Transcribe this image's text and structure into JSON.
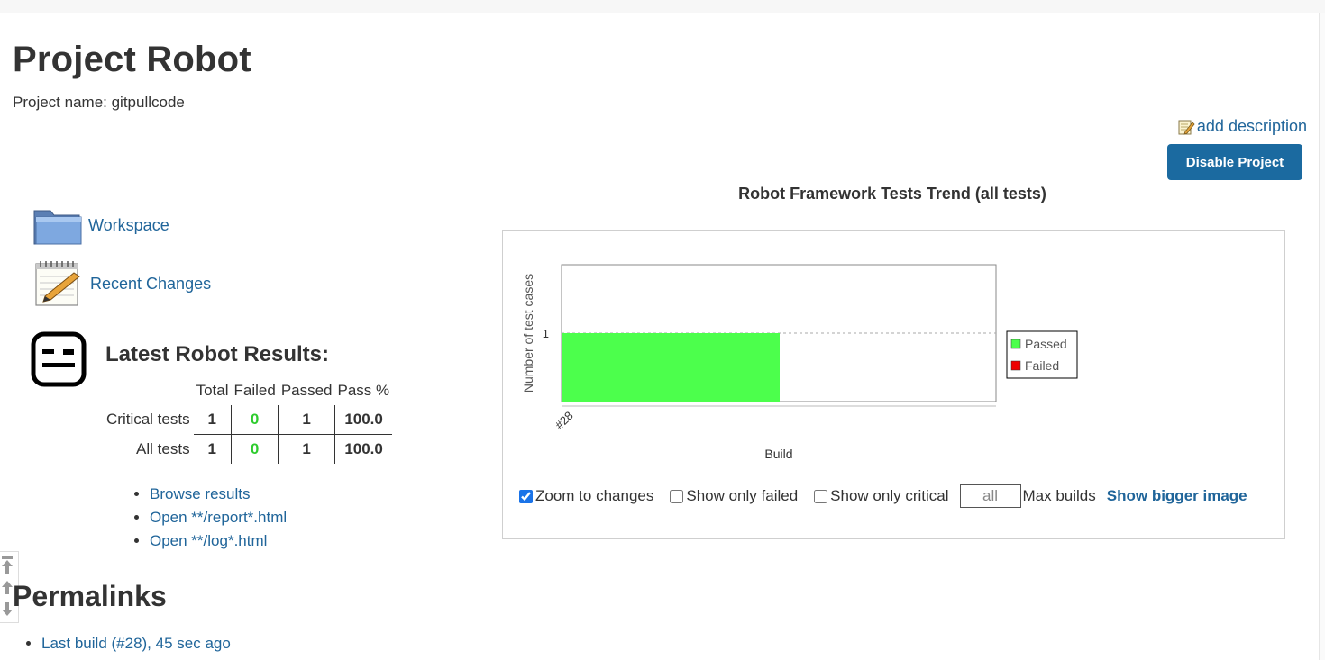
{
  "page": {
    "title": "Project Robot",
    "project_name": "Project name: gitpullcode"
  },
  "actions": {
    "add_description": "add description",
    "disable_project": "Disable Project"
  },
  "tasks": [
    {
      "label": "Workspace",
      "icon": "folder-icon"
    },
    {
      "label": "Recent Changes",
      "icon": "notepad-icon"
    }
  ],
  "robot": {
    "heading": "Latest Robot Results:",
    "headers": [
      "Total",
      "Failed",
      "Passed",
      "Pass %"
    ],
    "rows": [
      {
        "label": "Critical tests",
        "total": "1",
        "failed": "0",
        "passed": "1",
        "pass_pct": "100.0"
      },
      {
        "label": "All tests",
        "total": "1",
        "failed": "0",
        "passed": "1",
        "pass_pct": "100.0"
      }
    ],
    "links": [
      "Browse results",
      "Open **/report*.html",
      "Open **/log*.html"
    ]
  },
  "permalinks": {
    "heading": "Permalinks",
    "items": [
      "Last build (#28), 45 sec ago"
    ]
  },
  "chart": {
    "title": "Robot Framework Tests Trend (all tests)",
    "controls": {
      "zoom_label": "Zoom to changes",
      "zoom_checked": true,
      "failed_label": "Show only failed",
      "failed_checked": false,
      "critical_label": "Show only critical",
      "critical_checked": false,
      "max_builds_value": "all",
      "max_builds_label": "Max builds",
      "bigger_image": "Show bigger image"
    }
  },
  "chart_data": {
    "type": "area",
    "title": "",
    "xlabel": "Build",
    "ylabel": "Number of test cases",
    "categories": [
      "#28"
    ],
    "yticks": [
      1
    ],
    "series": [
      {
        "name": "Passed",
        "values": [
          1
        ],
        "color": "#4cff4c"
      },
      {
        "name": "Failed",
        "values": [
          0
        ],
        "color": "#ee0000"
      }
    ],
    "grid": true,
    "legend": "right"
  }
}
